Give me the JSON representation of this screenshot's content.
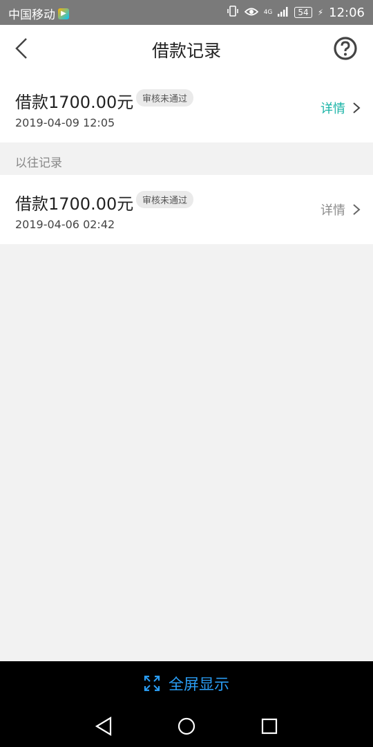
{
  "status_bar": {
    "carrier": "中国移动",
    "network": "4G",
    "battery": "54",
    "time": "12:06"
  },
  "header": {
    "title": "借款记录",
    "back_icon": "chevron-left-icon",
    "help_icon": "question-circle-icon"
  },
  "current_record": {
    "amount": "借款1700.00元",
    "status": "审核未通过",
    "date": "2019-04-09 12:05",
    "detail_label": "详情"
  },
  "section": {
    "title": "以往记录"
  },
  "past_records": [
    {
      "amount": "借款1700.00元",
      "status": "审核未通过",
      "date": "2019-04-06 02:42",
      "detail_label": "详情"
    }
  ],
  "bottom_bar": {
    "fullscreen_label": "全屏显示"
  },
  "colors": {
    "accent": "#19b3a6",
    "fullscreen_blue": "#2a9df4",
    "background": "#f2f2f2"
  }
}
